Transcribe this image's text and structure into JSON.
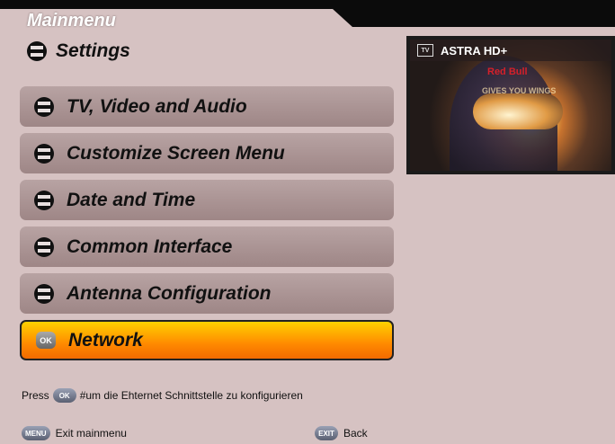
{
  "header": {
    "title": "Mainmenu",
    "subtitle": "Settings"
  },
  "menu": {
    "items": [
      {
        "label": "TV, Video and Audio",
        "icon": "arrow-icon"
      },
      {
        "label": "Customize Screen Menu",
        "icon": "arrow-icon"
      },
      {
        "label": "Date and Time",
        "icon": "arrow-icon"
      },
      {
        "label": "Common Interface",
        "icon": "arrow-icon"
      },
      {
        "label": "Antenna Configuration",
        "icon": "arrow-icon"
      },
      {
        "label": "Network",
        "icon": "ok-icon",
        "selected": true
      }
    ]
  },
  "preview": {
    "channel": "ASTRA HD+",
    "tv_badge": "TV",
    "sponsor_text": "Red Bull",
    "slogan_text": "GIVES YOU WINGS"
  },
  "hint": {
    "prefix": "Press",
    "button": "OK",
    "text": "#um die Ehternet Schnittstelle zu konfigurieren"
  },
  "footer": {
    "left_button": "MENU",
    "left_label": "Exit mainmenu",
    "right_button": "EXIT",
    "right_label": "Back"
  },
  "colors": {
    "panel_bg": "#d6c2c2",
    "item_bg": "#a89090",
    "selected_gradient_top": "#ffd100",
    "selected_gradient_bottom": "#f26a00"
  }
}
